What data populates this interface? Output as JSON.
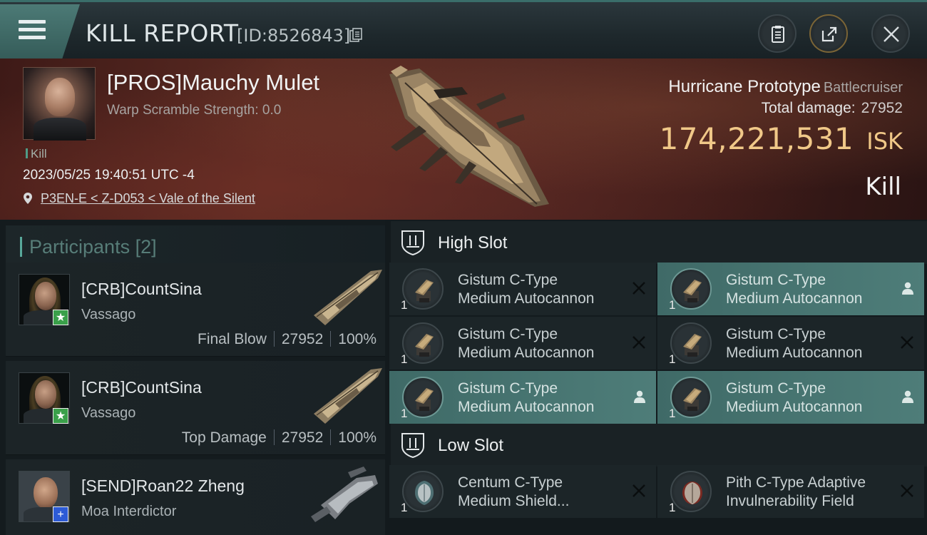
{
  "header": {
    "title": "KILL REPORT",
    "report_id": "[ID:8526843]"
  },
  "victim": {
    "name": "[PROS]Mauchy Mulet",
    "warp_scramble": "Warp Scramble Strength: 0.0",
    "tag": "Kill",
    "datetime": "2023/05/25 19:40:51 UTC -4",
    "location": "P3EN-E < Z-D053 < Vale of the Silent",
    "ship_name": "Hurricane Prototype",
    "ship_class": "Battlecruiser",
    "total_damage_label": "Total damage:",
    "total_damage": "27952",
    "isk_value": "174,221,531",
    "isk_unit": "ISK",
    "outcome": "Kill"
  },
  "participants": {
    "label": "Participants",
    "count": "[2]",
    "items": [
      {
        "name": "[CRB]CountSina",
        "ship": "Vassago",
        "role": "Final Blow",
        "damage": "27952",
        "percent": "100%",
        "badge": "★"
      },
      {
        "name": "[CRB]CountSina",
        "ship": "Vassago",
        "role": "Top Damage",
        "damage": "27952",
        "percent": "100%",
        "badge": "★"
      },
      {
        "name": "[SEND]Roan22 Zheng",
        "ship": "Moa Interdictor",
        "role": "",
        "damage": "",
        "percent": "",
        "badge": "+"
      }
    ]
  },
  "fitting": {
    "high_slot_label": "High Slot",
    "low_slot_label": "Low Slot",
    "high_slot": [
      {
        "name_line1": "Gistum C-Type",
        "name_line2": "Medium Autocannon",
        "qty": "1",
        "state": "destroyed"
      },
      {
        "name_line1": "Gistum C-Type",
        "name_line2": "Medium Autocannon",
        "qty": "1",
        "state": "dropped"
      },
      {
        "name_line1": "Gistum C-Type",
        "name_line2": "Medium Autocannon",
        "qty": "1",
        "state": "destroyed"
      },
      {
        "name_line1": "Gistum C-Type",
        "name_line2": "Medium Autocannon",
        "qty": "1",
        "state": "destroyed"
      },
      {
        "name_line1": "Gistum C-Type",
        "name_line2": "Medium Autocannon",
        "qty": "1",
        "state": "dropped"
      },
      {
        "name_line1": "Gistum C-Type",
        "name_line2": "Medium Autocannon",
        "qty": "1",
        "state": "dropped"
      }
    ],
    "low_slot": [
      {
        "name_line1": "Centum C-Type",
        "name_line2": "Medium Shield...",
        "qty": "1",
        "state": "destroyed"
      },
      {
        "name_line1": "Pith C-Type Adaptive",
        "name_line2": "Invulnerability Field",
        "qty": "1",
        "state": "destroyed"
      }
    ]
  },
  "icons": {
    "menu": "menu-icon",
    "copy": "copy-icon",
    "clipboard": "clipboard-icon",
    "share": "share-icon",
    "close": "close-icon",
    "location": "location-pin-icon",
    "slot": "slot-shield-icon",
    "destroyed": "x-icon",
    "dropped": "person-icon"
  },
  "colors": {
    "accent": "#58a89a",
    "isk": "#f0c888",
    "dropped_bg": "#4e7d79"
  }
}
